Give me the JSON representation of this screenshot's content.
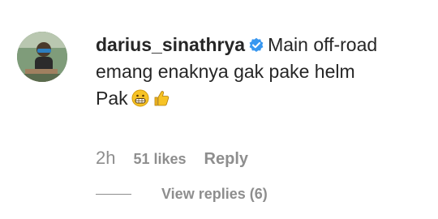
{
  "comment": {
    "username": "darius_sinathrya",
    "verified_icon": "verified-badge-icon",
    "text_line1": "Main off-road",
    "text_line2": "emang enaknya gak pake helm",
    "text_line3": "Pak",
    "emojis": [
      "grinning-face-emoji-icon",
      "thumbs-up-emoji-icon"
    ]
  },
  "meta": {
    "time": "2h",
    "likes": "51 likes",
    "reply_label": "Reply"
  },
  "replies": {
    "label": "View replies (6)"
  },
  "colors": {
    "text": "#262626",
    "muted": "#8e8e8e",
    "verified": "#3897f0"
  }
}
